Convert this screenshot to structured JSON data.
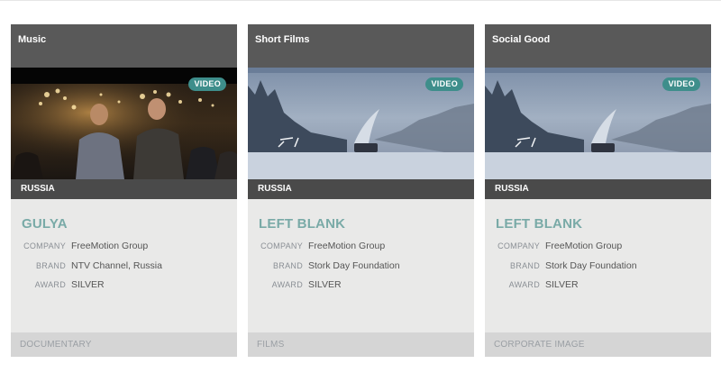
{
  "cards": [
    {
      "category": "Music",
      "media_type": "VIDEO",
      "country": "RUSSIA",
      "title": "GULYA",
      "company_label": "COMPANY",
      "company": "FreeMotion Group",
      "brand_label": "BRAND",
      "brand": "NTV Channel, Russia",
      "award_label": "AWARD",
      "award": "SILVER",
      "footer": "DOCUMENTARY"
    },
    {
      "category": "Short Films",
      "media_type": "VIDEO",
      "country": "RUSSIA",
      "title": "LEFT BLANK",
      "company_label": "COMPANY",
      "company": "FreeMotion Group",
      "brand_label": "BRAND",
      "brand": "Stork Day Foundation",
      "award_label": "AWARD",
      "award": "SILVER",
      "footer": "FILMS"
    },
    {
      "category": "Social Good",
      "media_type": "VIDEO",
      "country": "RUSSIA",
      "title": "LEFT BLANK",
      "company_label": "COMPANY",
      "company": "FreeMotion Group",
      "brand_label": "BRAND",
      "brand": "Stork Day Foundation",
      "award_label": "AWARD",
      "award": "SILVER",
      "footer": "CORPORATE IMAGE"
    }
  ],
  "colors": {
    "header_bg": "#595959",
    "country_bar_bg": "#4a4a4a",
    "badge_bg": "#3e8e8b",
    "title": "#79aaa7",
    "card_bg": "#e9e9e8",
    "footer_bg": "#d5d5d5"
  }
}
